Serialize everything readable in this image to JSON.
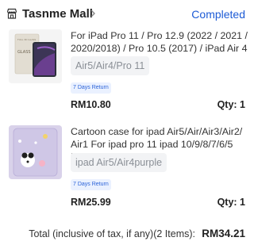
{
  "store": {
    "name": "Tasnme Mall",
    "status": "Completed",
    "icon": "store-icon",
    "chevron_icon": "chevron-right-icon"
  },
  "items": [
    {
      "title": "For iPad Pro 11 / Pro 12.9 (2022 / 2021 / 2020/2018) / Pro 10.5 (2017) / iPad Air 4 (1...",
      "variant": "Air5/Air4/Pro 11",
      "badge": "7 Days Return",
      "price": "RM10.80",
      "qty": "Qty: 1",
      "thumbnail": "screen-protector-product-image"
    },
    {
      "title": "Cartoon case for ipad Air5/Air/Air3/Air2/ Air1 For ipad pro 11 ipad 10/9/8/7/6/5 For...",
      "variant": "ipad Air5/Air4purple",
      "badge": "7 Days Return",
      "price": "RM25.99",
      "qty": "Qty: 1",
      "thumbnail": "cartoon-case-product-image"
    }
  ],
  "summary": {
    "total_label": "Total (inclusive of tax, if any)(2 Items):",
    "total_amount": "RM34.21"
  },
  "colors": {
    "accent": "#1d5bd6",
    "badge_bg": "#eaf1ff",
    "variant_bg": "#f2f3f5"
  }
}
